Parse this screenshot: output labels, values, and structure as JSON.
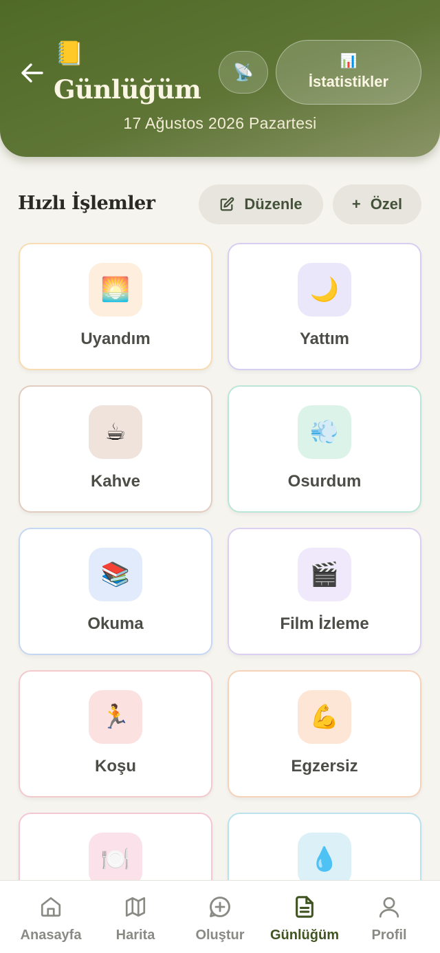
{
  "header": {
    "title_emoji": "📒",
    "title": "Günlüğüm",
    "date": "17 Ağustos 2026 Pazartesi",
    "satellite_emoji": "📡",
    "stats_emoji": "📊",
    "stats_label": "İstatistikler"
  },
  "quick_actions": {
    "title": "Hızlı İşlemler",
    "edit_label": "Düzenle",
    "custom_label": "Özel",
    "custom_prefix": "+",
    "items": [
      {
        "emoji": "🌅",
        "label": "Uyandım",
        "border": "#f8dcb2",
        "bg": "#fdeedd"
      },
      {
        "emoji": "🌙",
        "label": "Yattım",
        "border": "#d6cdf3",
        "bg": "#ebe7fb"
      },
      {
        "emoji": "☕",
        "label": "Kahve",
        "border": "#e2cbbf",
        "bg": "#efe3dc"
      },
      {
        "emoji": "💨",
        "label": "Osurdum",
        "border": "#b9e6d6",
        "bg": "#dcf3ea"
      },
      {
        "emoji": "📚",
        "label": "Okuma",
        "border": "#c4d7f5",
        "bg": "#e2ebfb"
      },
      {
        "emoji": "🎬",
        "label": "Film İzleme",
        "border": "#dccff4",
        "bg": "#efe9fb"
      },
      {
        "emoji": "🏃",
        "label": "Koşu",
        "border": "#f4c9cb",
        "bg": "#fce1e1"
      },
      {
        "emoji": "💪",
        "label": "Egzersiz",
        "border": "#f6d2b8",
        "bg": "#fde6d5"
      },
      {
        "emoji": "🍽️",
        "label": "",
        "border": "#f4c7d5",
        "bg": "#fbe1ea"
      },
      {
        "emoji": "💧",
        "label": "",
        "border": "#b9e2ee",
        "bg": "#dcf1f7"
      }
    ]
  },
  "nav": {
    "items": [
      {
        "label": "Anasayfa"
      },
      {
        "label": "Harita"
      },
      {
        "label": "Oluştur"
      },
      {
        "label": "Günlüğüm"
      },
      {
        "label": "Profil"
      }
    ],
    "active_color": "#3f5420",
    "inactive_color": "#8a8a85"
  },
  "colors": {
    "header_green": "#56702b",
    "background": "#f6f4ef"
  }
}
